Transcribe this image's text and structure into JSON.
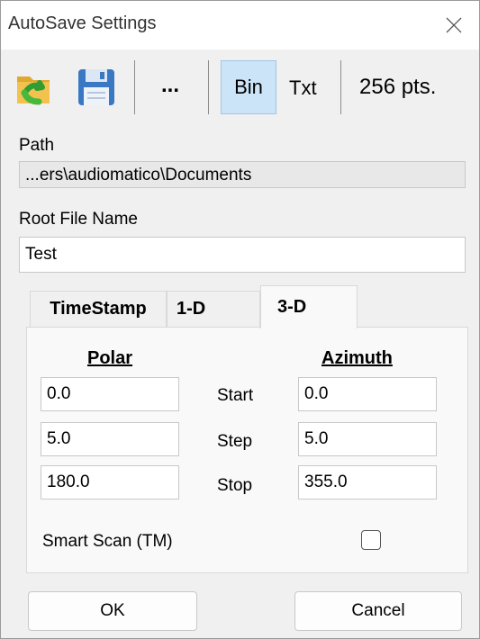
{
  "window": {
    "title": "AutoSave Settings"
  },
  "toolbar": {
    "open_icon": "folder-open-arrow-icon",
    "save_icon": "floppy-disk-icon",
    "browse_label": "...",
    "bin_label": "Bin",
    "txt_label": "Txt",
    "points_label": "256 pts."
  },
  "path": {
    "label": "Path",
    "value": "...ers\\audiomatico\\Documents"
  },
  "root_file": {
    "label": "Root File Name",
    "value": "Test"
  },
  "tabs": [
    {
      "label": "TimeStamp",
      "active": false
    },
    {
      "label": "1-D",
      "active": false
    },
    {
      "label": "3-D",
      "active": true
    }
  ],
  "panel": {
    "polar_header": "Polar",
    "azimuth_header": "Azimuth",
    "rows": [
      {
        "label": "Start",
        "polar": "0.0",
        "azimuth": "0.0"
      },
      {
        "label": "Step",
        "polar": "5.0",
        "azimuth": "5.0"
      },
      {
        "label": "Stop",
        "polar": "180.0",
        "azimuth": "355.0"
      }
    ],
    "smart_scan_label": "Smart Scan (TM)",
    "smart_scan_checked": false
  },
  "buttons": {
    "ok": "OK",
    "cancel": "Cancel"
  }
}
